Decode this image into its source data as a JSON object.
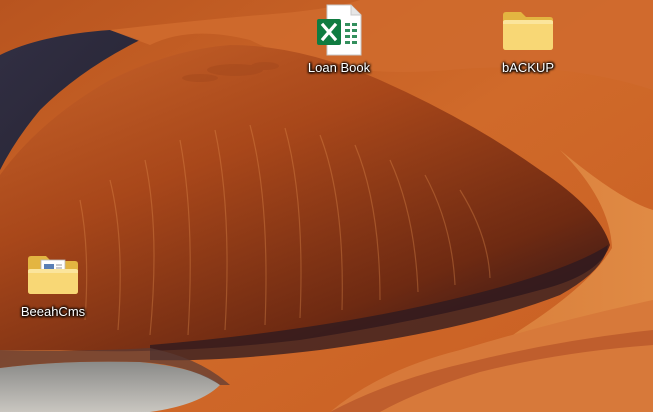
{
  "desktop": {
    "wallpaper_icon": "desert-dune-wallpaper",
    "icons": [
      {
        "label": "Loan Book",
        "icon": "excel-file-icon"
      },
      {
        "label": "bACKUP",
        "icon": "folder-icon"
      },
      {
        "label": "BeeahCms",
        "icon": "folder-with-document-icon"
      }
    ]
  },
  "colors": {
    "excel_green": "#107c41",
    "folder_yellow": "#f8d775",
    "folder_dark": "#e3b541"
  }
}
